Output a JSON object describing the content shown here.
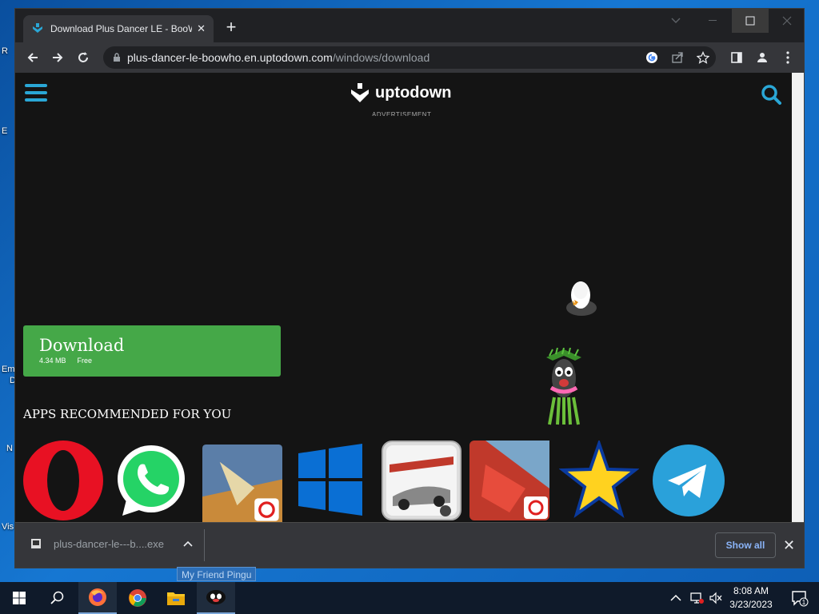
{
  "desktop": {
    "labels": [
      "R",
      "E",
      "Em",
      "D",
      "N",
      "Vis"
    ]
  },
  "browser": {
    "tab": {
      "title": "Download Plus Dancer LE - Boo​W",
      "close": "✕"
    },
    "newtab": "+",
    "address": {
      "host": "plus-dancer-le-boowho.en.uptodown.com",
      "path": "/windows/download"
    }
  },
  "page": {
    "logo": "uptodown",
    "ad_label": "ADVERTISEMENT",
    "download": {
      "label": "Download",
      "size": "4.34 MB",
      "license": "Free"
    },
    "recommended_title": "APPS RECOMMENDED FOR YOU",
    "apps": [
      "Opera",
      "WhatsApp",
      "Free Fire MAX",
      "Windows",
      "Need for Speed Most Wanted",
      "Garena Free Fire",
      "Star",
      "Telegram"
    ]
  },
  "shelf": {
    "file": "plus-dancer-le---b....exe",
    "show_all": "Show all",
    "close": "✕"
  },
  "tooltip": "My Friend Pingu",
  "taskbar": {
    "time": "8:08 AM",
    "date": "3/23/2023",
    "notifications": "1"
  },
  "colors": {
    "accent": "#2aa7d6",
    "download_green": "#45a848",
    "page_bg": "#141414"
  }
}
